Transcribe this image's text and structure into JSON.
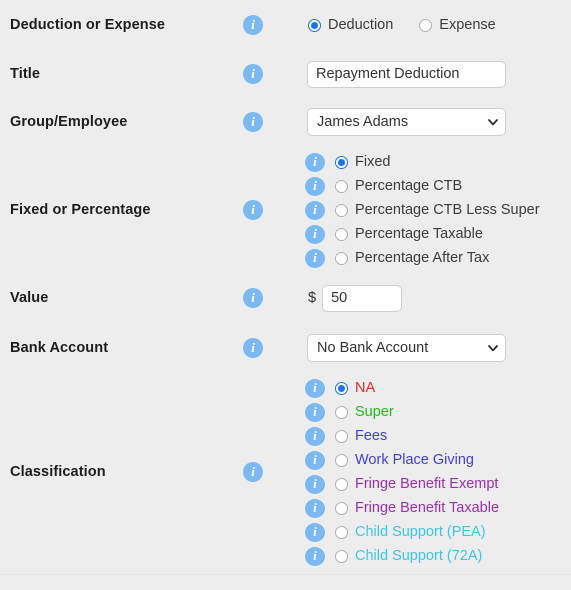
{
  "form": {
    "rows": [
      {
        "label": "Deduction or Expense",
        "type": "inline-radio",
        "options": [
          {
            "label": "Deduction",
            "checked": true
          },
          {
            "label": "Expense",
            "checked": false
          }
        ]
      },
      {
        "label": "Title",
        "type": "text",
        "value": "Repayment Deduction",
        "placeholder": ""
      },
      {
        "label": "Group/Employee",
        "type": "select",
        "value": "James Adams"
      },
      {
        "label": "Fixed or Percentage",
        "type": "stacked-radio",
        "options": [
          {
            "label": "Fixed",
            "checked": true,
            "color": "#3c3c3c"
          },
          {
            "label": "Percentage CTB",
            "checked": false,
            "color": "#3c3c3c"
          },
          {
            "label": "Percentage CTB Less Super",
            "checked": false,
            "color": "#3c3c3c"
          },
          {
            "label": "Percentage Taxable",
            "checked": false,
            "color": "#3c3c3c"
          },
          {
            "label": "Percentage After Tax",
            "checked": false,
            "color": "#3c3c3c"
          }
        ]
      },
      {
        "label": "Value",
        "type": "currency",
        "prefix": "$",
        "value": "50",
        "placeholder": ""
      },
      {
        "label": "Bank Account",
        "type": "select",
        "value": "No Bank Account"
      },
      {
        "label": "Classification",
        "type": "stacked-radio",
        "options": [
          {
            "label": "NA",
            "checked": true,
            "color": "#e02b2b"
          },
          {
            "label": "Super",
            "checked": false,
            "color": "#22bb22"
          },
          {
            "label": "Fees",
            "checked": false,
            "color": "#4040dd"
          },
          {
            "label": "Work Place Giving",
            "checked": false,
            "color": "#4040dd"
          },
          {
            "label": "Fringe Benefit Exempt",
            "checked": false,
            "color": "#9b30b0"
          },
          {
            "label": "Fringe Benefit Taxable",
            "checked": false,
            "color": "#9b30b0"
          },
          {
            "label": "Child Support (PEA)",
            "checked": false,
            "color": "#3bc6e8"
          },
          {
            "label": "Child Support (72A)",
            "checked": false,
            "color": "#3bc6e8"
          }
        ]
      }
    ]
  },
  "icons": {
    "info": "i",
    "info_name": "info-icon",
    "chevron_name": "chevron-down-icon"
  },
  "colors": {
    "background": "#ededed",
    "info_icon": "#7cb9f2",
    "radio_checked": "#1a73e8",
    "input_border": "#cfcfcf",
    "label_text": "#1d1d1d"
  }
}
